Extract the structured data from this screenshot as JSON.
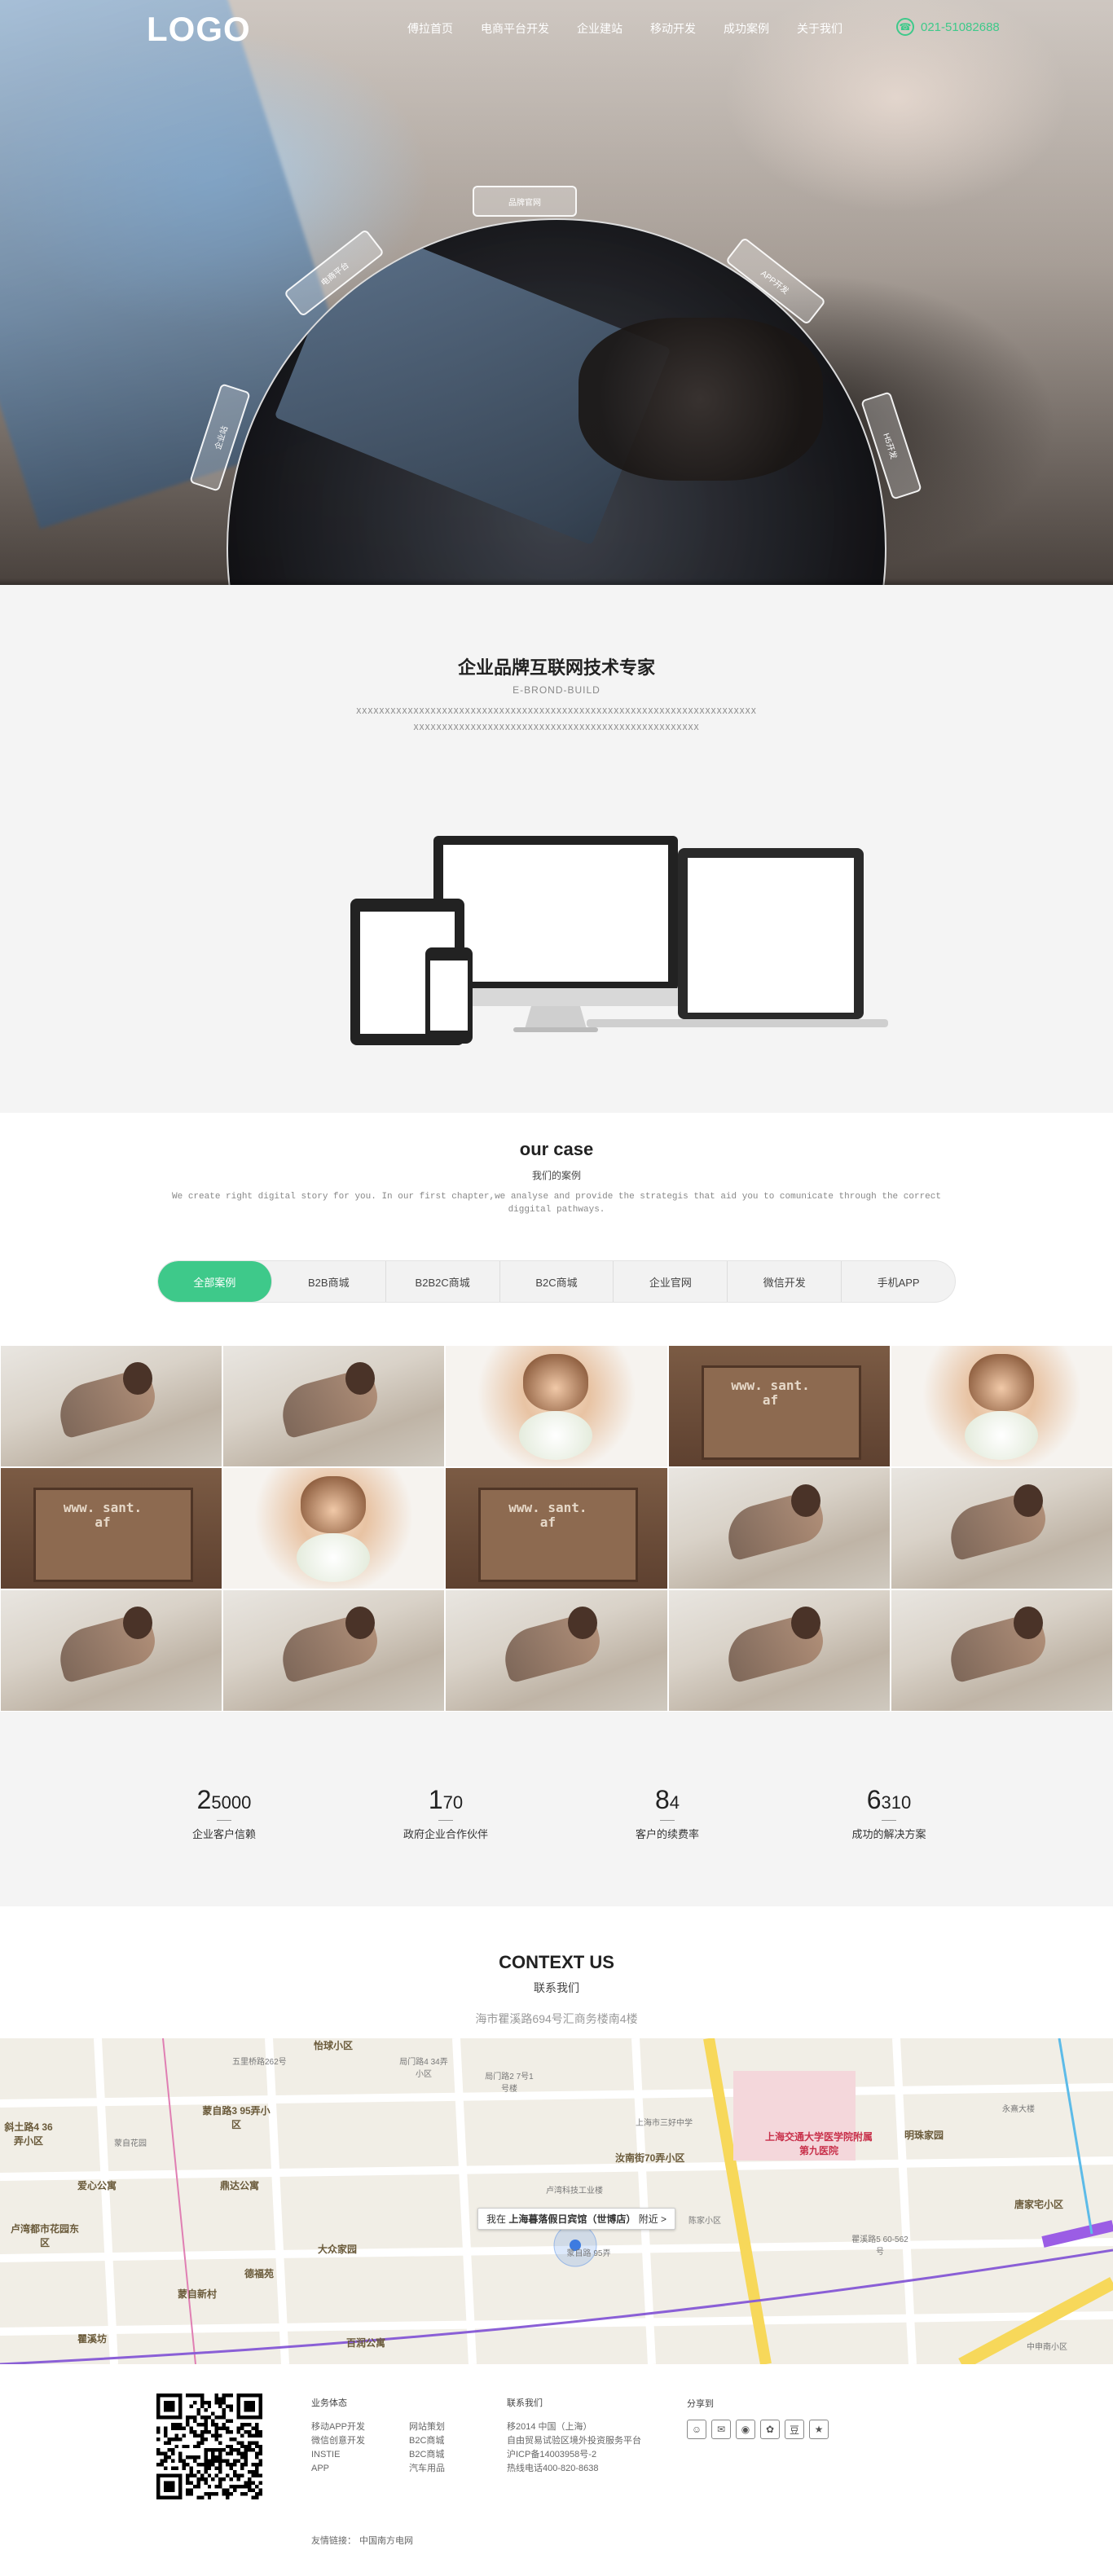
{
  "nav": {
    "logo": "LOGO",
    "items": [
      "傅拉首页",
      "电商平台开发",
      "企业建站",
      "移动开发",
      "成功案例",
      "关于我们"
    ],
    "phone": "021-51082688"
  },
  "hero": {
    "tabs": [
      "品牌官网",
      "电商平台",
      "APP开发",
      "企业站",
      "H5开发"
    ]
  },
  "intro": {
    "title": "企业品牌互联网技术专家",
    "subtitle": "E-BROND-BUILD",
    "line1": "XXXXXXXXXXXXXXXXXXXXXXXXXXXXXXXXXXXXXXXXXXXXXXXXXXXXXXXXXXXXXXXXXXXXXX",
    "line2": "XXXXXXXXXXXXXXXXXXXXXXXXXXXXXXXXXXXXXXXXXXXXXXXXXX"
  },
  "cases": {
    "title": "our case",
    "subtitle": "我们的案例",
    "desc": "We create right digital story for you. In our first chapter,we analyse and provide the strategis that aid you to comunicate through the correct diggital pathways.",
    "filters": [
      "全部案例",
      "B2B商城",
      "B2B2C商城",
      "B2C商城",
      "企业官网",
      "微信开发",
      "手机APP"
    ],
    "active_filter": "全部案例",
    "grid": [
      "a",
      "a",
      "b",
      "c",
      "b",
      "c",
      "b",
      "c",
      "a",
      "a",
      "a",
      "a",
      "a",
      "a",
      "a"
    ]
  },
  "stats": [
    {
      "big": "2",
      "small": "5000",
      "label": "企业客户信赖"
    },
    {
      "big": "1",
      "small": "70",
      "label": "政府企业合作伙伴"
    },
    {
      "big": "8",
      "small": "4",
      "label": "客户的续费率"
    },
    {
      "big": "6",
      "small": "310",
      "label": "成功的解决方案"
    }
  ],
  "contact": {
    "title": "CONTEXT US",
    "subtitle": "联系我们",
    "address": "海市瞿溪路694号汇商务楼南4楼",
    "map_pin_prefix": "我在",
    "map_pin_place": "上海暮落假日宾馆（世博店）",
    "map_pin_suffix": "附近 >",
    "map_labels": [
      "怡球小区",
      "五里桥路262号",
      "蒙自路3 95弄小区",
      "蒙自花园",
      "爱心公寓",
      "鼎达公寓",
      "卢湾都市花园东区",
      "德福苑",
      "大众家园",
      "蒙自新村",
      "瞿溪坊",
      "百润公寓",
      "局门路4 34弄小区",
      "局门路2 7号1号楼",
      "上海市三好中学",
      "汝南街70弄小区",
      "卢湾科技工业楼",
      "上海交通大学医学院附属第九医院",
      "明珠家园",
      "永熹大楼",
      "唐家宅小区",
      "瞿溪路5 60-562号",
      "蒙自路 95弄",
      "中申南小区",
      "斜土路4 36弄小区",
      "陈家小区",
      "上海暮落假日宾馆（世博店）"
    ]
  },
  "footer": {
    "col1": {
      "title": "业务体态",
      "items": [
        "移动APP开发",
        "微信创意开发",
        "INSTIE",
        "APP"
      ]
    },
    "col2": {
      "title": "",
      "items": [
        "网站策划",
        "B2C商城",
        "B2C商城",
        "汽车用品"
      ]
    },
    "col3": {
      "title": "联系我们",
      "items": [
        "移2014 中国（上海）",
        "自由贸易试验区境外投资服务平台",
        "沪ICP备14003958号-2",
        "热线电话400-820-8638"
      ]
    },
    "share": {
      "title": "分享到",
      "icons": [
        "qq-icon",
        "wechat-icon",
        "weibo-icon",
        "sina-icon",
        "douban-icon",
        "star-icon"
      ]
    },
    "friend_prefix": "友情链接：",
    "friend_link": "中国南方电网"
  }
}
